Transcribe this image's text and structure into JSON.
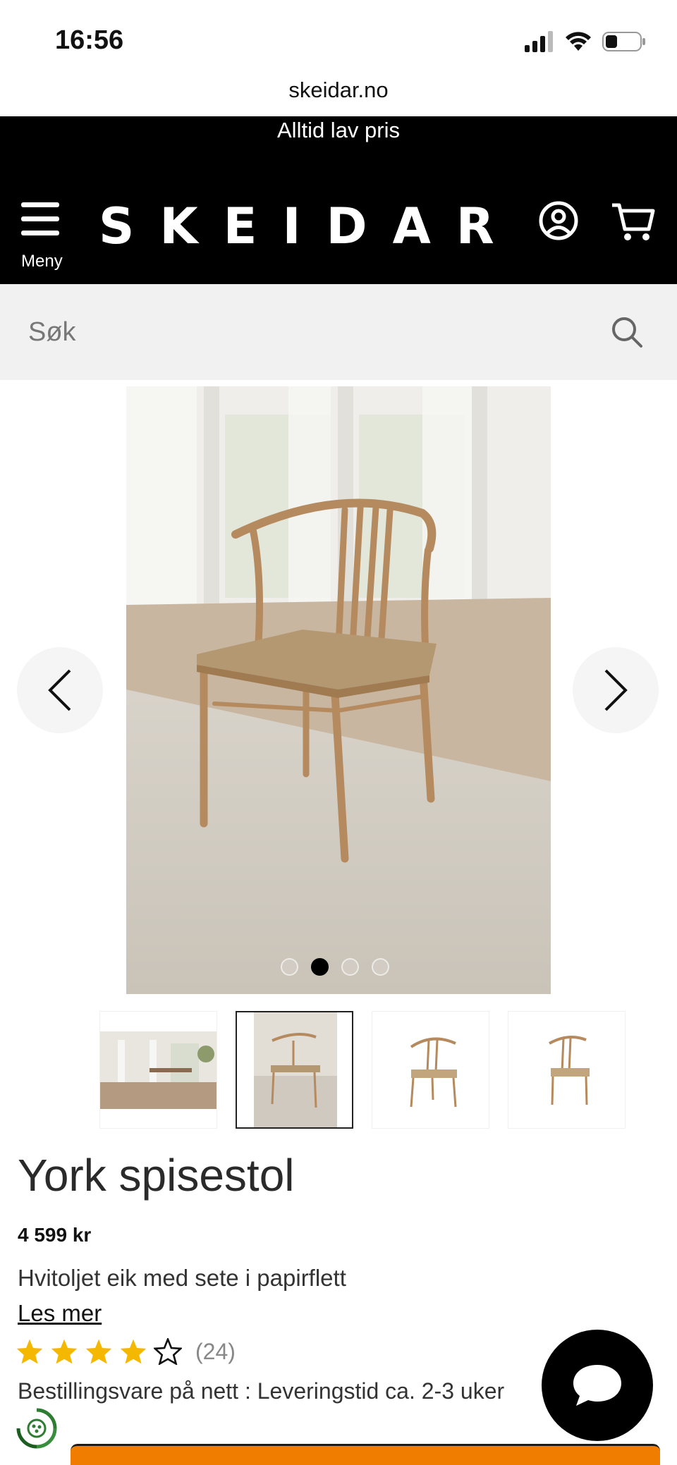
{
  "status_bar": {
    "time": "16:56",
    "icons": [
      "signal-icon",
      "wifi-icon",
      "battery-icon"
    ]
  },
  "browser": {
    "url": "skeidar.no"
  },
  "header": {
    "promo_text": "Alltid lav pris",
    "menu_label": "Meny",
    "logo_text": "SKEIDAR",
    "icons": [
      "menu-icon",
      "account-icon",
      "cart-icon"
    ]
  },
  "search": {
    "placeholder": "Søk",
    "value": ""
  },
  "gallery": {
    "image_count": 4,
    "active_index": 1,
    "thumbnails": [
      "room-scene",
      "chair-on-rug",
      "chair-front",
      "chair-angle"
    ]
  },
  "product": {
    "title": "York spisestol",
    "price": "4 599 kr",
    "description": "Hvitoljet eik med sete i papirflett",
    "read_more": "Les mer",
    "rating": {
      "stars": 4,
      "max": 5,
      "count_label": "(24)"
    },
    "delivery": "Bestillingsvare på nett : Leveringstid ca. 2-3 uker"
  },
  "colors": {
    "header_bg": "#000000",
    "search_bg": "#f1f1f1",
    "star": "#f5b800",
    "cta": "#f07d00"
  }
}
